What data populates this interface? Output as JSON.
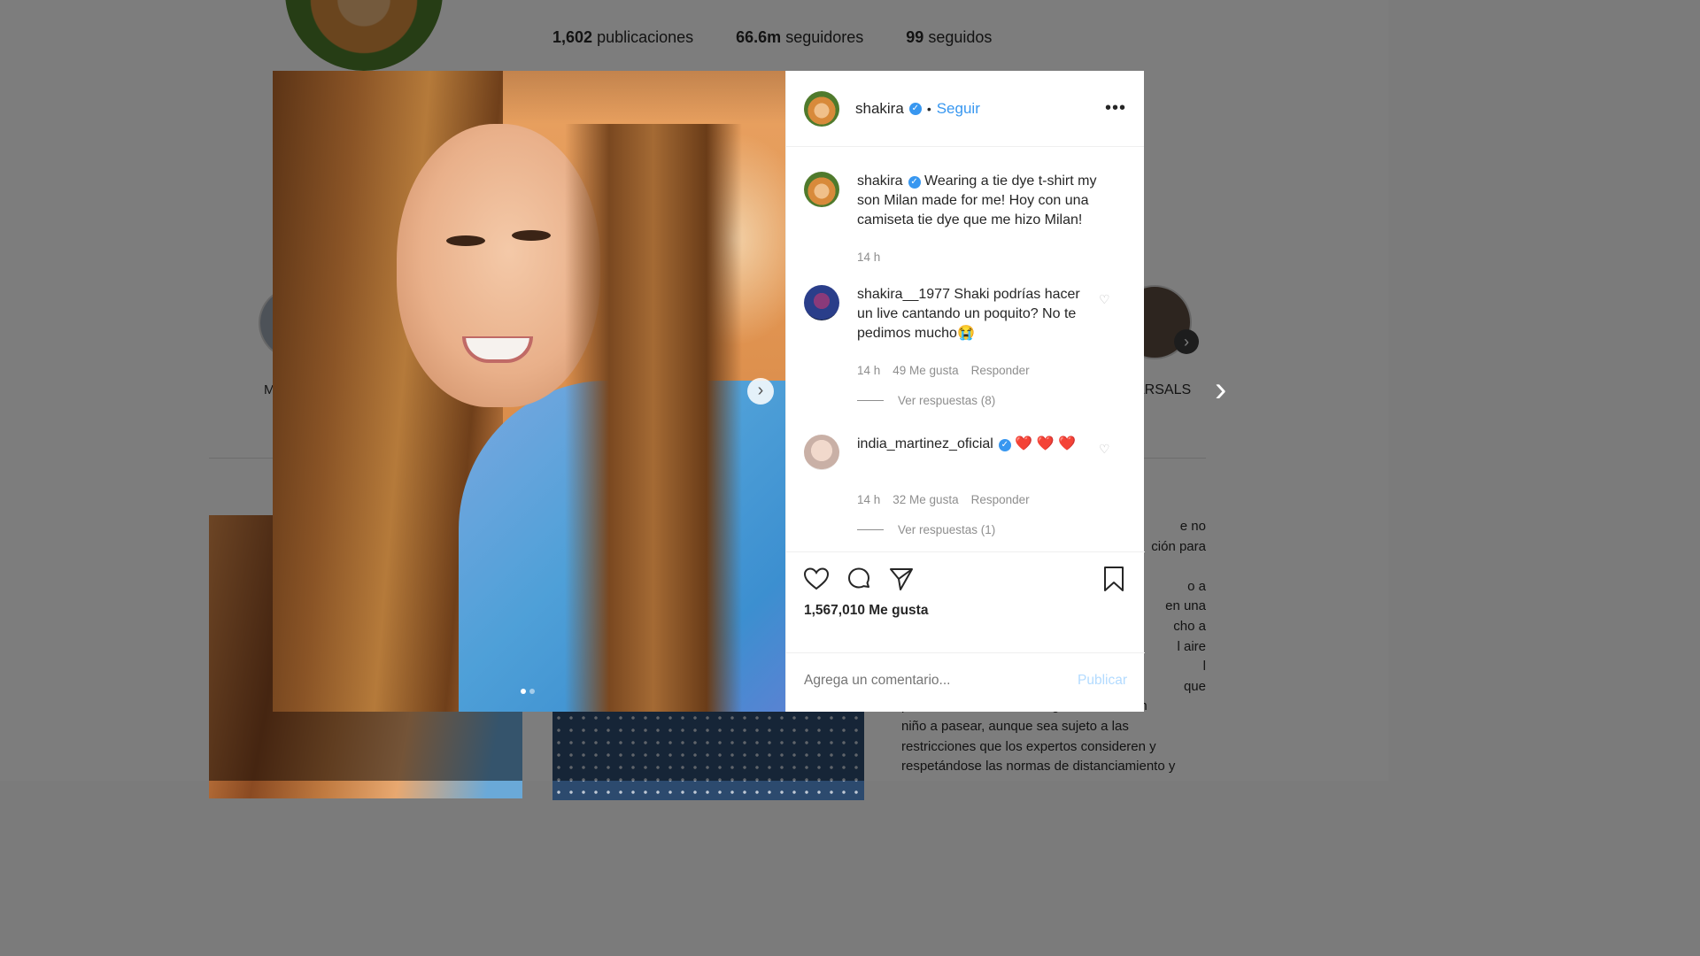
{
  "profile": {
    "stats": [
      {
        "count": "1,602",
        "label": "publicaciones"
      },
      {
        "count": "66.6m",
        "label": "seguidores"
      },
      {
        "count": "99",
        "label": "seguidos"
      }
    ],
    "highlight_left_label": "M",
    "highlight_right_label": "ARSALS",
    "bg_text_lines": [
      "e no",
      "ción para",
      "",
      "o a",
      "en una",
      "cho a",
      "l aire",
      "l",
      "que",
      "permita a un adulto encargado sacar a un",
      "niño a pasear, aunque sea sujeto a las",
      "restricciones que los expertos consideren y",
      "respetándose las normas de distanciamiento y"
    ]
  },
  "post": {
    "author": "shakira",
    "follow_label": "Seguir",
    "more_label": "•••",
    "caption": {
      "username": "shakira",
      "text": "Wearing a tie dye t-shirt my son Milan made for me! Hoy con una camiseta tie dye que me hizo Milan!",
      "time": "14 h"
    },
    "comments": [
      {
        "username": "shakira__1977",
        "text": "Shaki podrías hacer un live cantando un poquito? No te pedimos mucho😭",
        "time": "14 h",
        "likes": "49 Me gusta",
        "reply_label": "Responder",
        "view_replies": "Ver respuestas (8)"
      },
      {
        "username": "india_martinez_oficial",
        "text": "❤️ ❤️ ❤️",
        "time": "14 h",
        "likes": "32 Me gusta",
        "reply_label": "Responder",
        "view_replies": "Ver respuestas (1)"
      }
    ],
    "likes_count": "1,567,010 Me gusta",
    "comment_placeholder": "Agrega un comentario...",
    "publish_label": "Publicar",
    "carousel": {
      "total": 2,
      "active": 1
    }
  },
  "colors": {
    "link_blue": "#3897f0",
    "publish_disabled": "#b3dbff",
    "heart_red": "#e0262f"
  }
}
